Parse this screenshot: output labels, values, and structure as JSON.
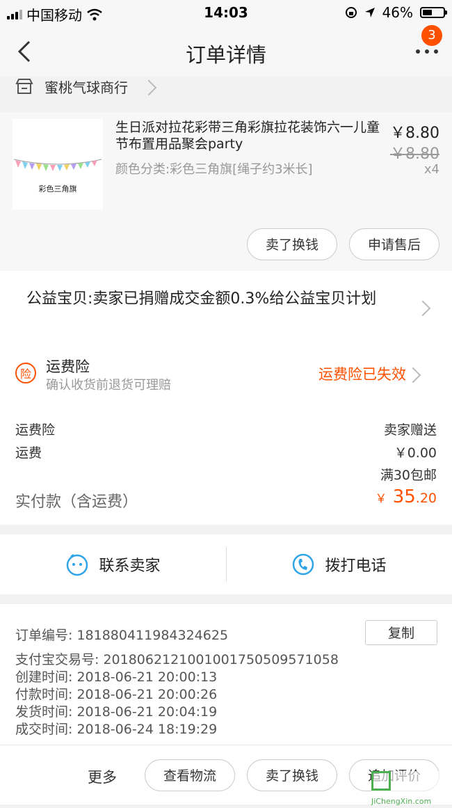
{
  "status_bar": {
    "carrier": "中国移动",
    "time": "14:03",
    "battery": "46%",
    "battery_level": 0.46
  },
  "nav": {
    "title": "订单详情",
    "badge": "3"
  },
  "shop": {
    "name": "蜜桃气球商行"
  },
  "item": {
    "thumb_caption": "彩色三角旗",
    "title": "生日派对拉花彩带三角彩旗拉花装饰六一儿童节布置用品聚会party",
    "sku": "颜色分类:彩色三角旗[绳子约3米长]",
    "price": "￥8.80",
    "original_price": "￥8.80",
    "quantity": "x4",
    "buttons": [
      "卖了换钱",
      "申请售后"
    ]
  },
  "charity": {
    "text": "公益宝贝:卖家已捐赠成交金额0.3%给公益宝贝计划"
  },
  "insurance": {
    "icon_char": "险",
    "title": "运费险",
    "subtitle": "确认收货前退货可理赔",
    "status": "运费险已失效"
  },
  "fees": {
    "rows": [
      {
        "label": "运费险",
        "value": "卖家赠送"
      },
      {
        "label": "运费",
        "value": "￥0.00"
      }
    ],
    "shipping_note": "满30包邮",
    "total_label": "实付款（含运费）",
    "total_currency": "￥",
    "total_int": "35",
    "total_dec": ".20"
  },
  "contact": {
    "seller": "联系卖家",
    "phone": "拨打电话"
  },
  "order_info": {
    "order_no": "订单编号:  181880411984324625",
    "alipay_no": "支付宝交易号:  2018062121001001750509571058",
    "created": "创建时间:   2018-06-21 20:00:13",
    "paid": "付款时间:   2018-06-21 20:00:26",
    "shipped": "发货时间:   2018-06-21 20:04:19",
    "completed": "成交时间:   2018-06-24 18:19:29",
    "copy_label": "复制"
  },
  "bottom_bar": {
    "more": "更多",
    "buttons": [
      "查看物流",
      "卖了换钱",
      "追加评价"
    ]
  },
  "watermark": {
    "text": "JiChengXin.com"
  },
  "colors": {
    "accent": "#ff5000",
    "icon_blue": "#2fa4e7"
  }
}
